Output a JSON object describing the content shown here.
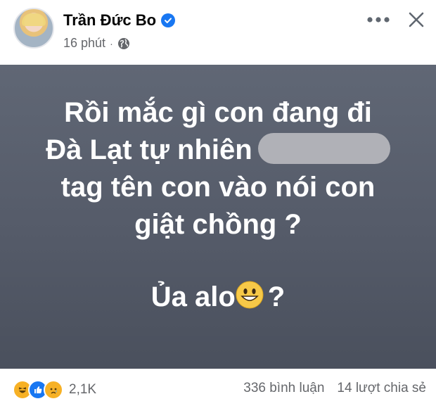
{
  "post": {
    "author": "Trần Đức Bo",
    "time": "16 phút",
    "separator": "·",
    "text_lines": [
      "Rồi mắc gì con đang đi",
      "Đà Lạt tự nhiên",
      "tag tên con vào nói con",
      "giật chồng ?",
      "Ủa alo",
      "?"
    ],
    "background_color": "#585e6b"
  },
  "reactions": {
    "icons": [
      "haha-icon",
      "like-icon",
      "sad-icon"
    ],
    "count": "2,1K"
  },
  "stats": {
    "comments": "336 bình luận",
    "shares": "14 lượt chia sẻ"
  },
  "colors": {
    "verified": "#1877f2",
    "meta_text": "#65676b"
  }
}
